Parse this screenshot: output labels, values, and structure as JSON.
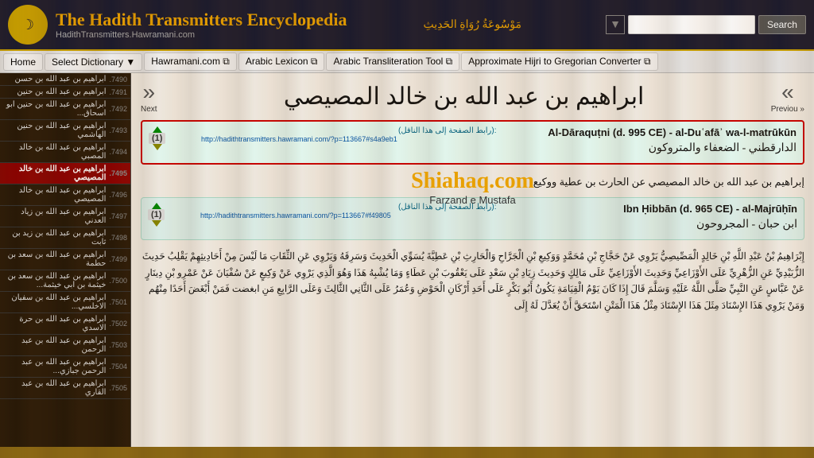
{
  "header": {
    "title": "The Hadith Transmitters Encyclopedia",
    "url": "HadithTransmitters.Hawramani.com",
    "arabic_tagline": "مَوْسُوعَةُ رُوَاةِ الحَدِيثِ",
    "search_placeholder": "",
    "search_label": "Search"
  },
  "navbar": {
    "items": [
      {
        "label": "Home",
        "has_arrow": false,
        "has_external": false
      },
      {
        "label": "Select Dictionary ▼",
        "has_arrow": true,
        "has_external": false
      },
      {
        "label": "Hawramani.com ⧉",
        "has_arrow": false,
        "has_external": true
      },
      {
        "label": "Arabic Lexicon ⧉",
        "has_arrow": false,
        "has_external": true
      },
      {
        "label": "Arabic Transliteration Tool ⧉",
        "has_arrow": false,
        "has_external": true
      },
      {
        "label": "Approximate Hijri to Gregorian Converter ⧉",
        "has_arrow": false,
        "has_external": true
      }
    ]
  },
  "sidebar": {
    "items": [
      {
        "num": ".7490",
        "text": "ابراهيم بن عبد الله بن حسن"
      },
      {
        "num": ".7491",
        "text": "ابراهيم بن عبد الله بن حنين"
      },
      {
        "num": ".7492",
        "text": "ابراهيم بن عبد الله بن حنين ابو اسحاق..."
      },
      {
        "num": ".7493",
        "text": "ابراهيم بن عبد الله بن حنين الهاشمي"
      },
      {
        "num": ".7494",
        "text": "ابراهيم بن عبد الله بن خالد المصبي"
      },
      {
        "num": ".7495",
        "text": "ابراهيم بن عبد الله بن خالد المصيصي",
        "active": true
      },
      {
        "num": ".7496",
        "text": "ابراهيم بن عبد الله بن خالد المصيصي"
      },
      {
        "num": ".7497",
        "text": "ابراهيم بن عبد الله بن زياد العدني"
      },
      {
        "num": ".7498",
        "text": "ابراهيم بن عبد الله بن زيد بن ثابت"
      },
      {
        "num": ".7499",
        "text": "ابراهيم بن عبد الله بن سعد بن حطمة"
      },
      {
        "num": ".7500",
        "text": "ابراهيم بن عبد الله بن سعد بن خيثمة بن ابي خيثمة..."
      },
      {
        "num": ".7501",
        "text": "ابراهيم بن عبد الله بن سفيان الاخلسي..."
      },
      {
        "num": ".7502",
        "text": "ابراهيم بن عبد الله بن حرة الاسدي"
      },
      {
        "num": ".7503",
        "text": "ابراهيم بن عبد الله بن عبد الرحمن"
      },
      {
        "num": ".7504",
        "text": "ابراهيم بن عبد الله بن عبد الرحمن جبازي..."
      },
      {
        "num": ".7505",
        "text": "ابراهيم بن عبد الله بن عبد القاري"
      }
    ]
  },
  "page": {
    "arabic_title": "ابراهيم بن عبد الله بن خالد المصيصي",
    "prev_label": "« Previou",
    "next_label": "Next »",
    "entries": [
      {
        "rank": "(1)",
        "permalink_label": ":(رابط الصفحة إلى هذا الناقل)",
        "url": "http://hadithtransmitters.hawramani.com/?p=113667#s4a9eb1",
        "source_title": "Al-Dāraquṭni (d. 995 CE) - al-Duʿafāʾ wa-l-matrūkūn",
        "arabic_source": "الدارقطني - الضعفاء والمتروكون",
        "highlighted": true
      },
      {
        "rank": "(1)",
        "permalink_label": ":(رابط الصفحة إلى هذا الناقل)",
        "url": "http://hadithtransmitters.hawramani.com/?p=113667#f49805",
        "source_title": "Ibn Ḥibbān (d. 965 CE) - al-Majrūḥīn",
        "arabic_source": "ابن حبان - المجروحون",
        "highlighted": false
      }
    ],
    "watermark_site": "Shiahaq.com",
    "watermark_sub": "Farzand e Mustafa",
    "arabic_paragraph_1": "إبراهيم بن عبد الله بن خالد المصيصي عن الحارث بن عطية ووكيع.",
    "arabic_paragraph_2": "إِبْرَاهِيمُ بْنُ عَبْدِ اللَّهِ بْنِ خَالِدٍ الْمَصِّيصِيُّ يَرْوِي عَنْ حَجَّاجِ بْنِ مُحَمَّدٍ وَوَكِيعِ بْنِ الْجَرَّاحِ وَالْحَارِثِ بْنِ عَطِيَّةَ يُسَوِّي الْحَدِيثَ وَسَرِقَهُ",
    "arabic_paragraph_3": "وَيَرْوِي عَنِ الثِّقَاتِ مَا لَيْسَ مِنْ أَحَادِيثِهِمْ يَقْلِبُ حَدِيثَ الزُّبَيْدِيِّ عَنِ الزُّهْرِيِّ عَلَى الأَوْزَاعِيِّ وَحَدِيثَ الأَوْزَاعِيِّ عَلَى مَالِكٍ",
    "arabic_paragraph_4": "وَحَدِيثَ زِيَادِ بْنِ سَعْدٍ عَلَى يَعْقُوبَ بْنِ عَطَاءٍ وَمَا يُشْبِهُ هَذَا وَهُوَ الَّذِي يَرْوِي عَنْ وَكِيعٍ عَنْ سُفْيَانَ عَنْ عَمْرِو بْنِ دِينَارٍ عَنْ",
    "arabic_paragraph_5": "عَبَّاسٍ عَنِ النَّبِيِّ صَلَّى اللَّهُ عَلَيْهِ وَسَلَّمَ قَالَ إِذَا كَانَ يَوْمُ الْقِيَامَةِ يَكُونُ أَبُو بَكْرٍ عَلَى أَحَدِ أَرْكَانِ الْحَوْضِ وَعُمَرُ عَلَى الثَّانِي",
    "arabic_paragraph_6": "الثَّالِثَ وَعَلَى الرَّابِعِ مَنِ ابغضت فَمَن أَبْغَضَ أَحَدًا مِنْهُم وَمَنْ يَرْوِي هَذَا الإِسْنَادَ مِثَلَ هَذَا الإِسْنَادَ مِثْلُ هَذَا الْمَتْنِ اسْتَحَقَّ أَنْ يُعَدَّلَ لَهُ إِلَى"
  }
}
